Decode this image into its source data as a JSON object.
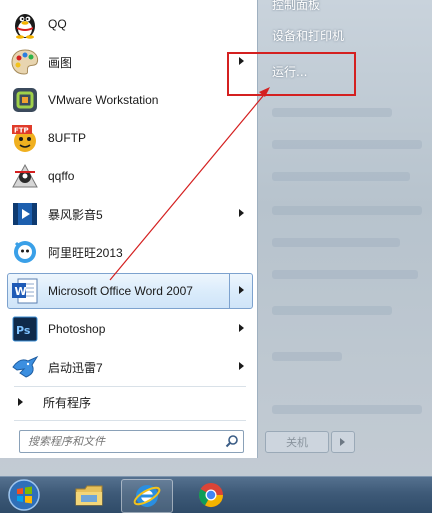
{
  "programs": [
    {
      "label": "QQ",
      "icon": "qq-penguin-icon",
      "has_arrow": false
    },
    {
      "label": "画图",
      "icon": "paint-palette-icon",
      "has_arrow": true
    },
    {
      "label": "VMware Workstation",
      "icon": "vmware-icon",
      "has_arrow": false
    },
    {
      "label": "8UFTP",
      "icon": "ftp-client-icon",
      "has_arrow": false
    },
    {
      "label": "qqffo",
      "icon": "qqffo-icon",
      "has_arrow": false
    },
    {
      "label": "暴风影音5",
      "icon": "baofeng-player-icon",
      "has_arrow": true
    },
    {
      "label": "阿里旺旺2013",
      "icon": "aliwangwang-icon",
      "has_arrow": false
    },
    {
      "label": "Microsoft Office Word 2007",
      "icon": "word-document-icon",
      "has_arrow": true,
      "highlighted": true
    },
    {
      "label": "Photoshop",
      "icon": "photoshop-icon",
      "has_arrow": true
    },
    {
      "label": "启动迅雷7",
      "icon": "thunder-bird-icon",
      "has_arrow": true
    }
  ],
  "all_programs_label": "所有程序",
  "search_placeholder": "搜索程序和文件",
  "right_pane": {
    "control_panel": "控制面板",
    "devices_printers": "设备和打印机",
    "run": "运行..."
  },
  "shutdown_label": "关机",
  "taskbar": [
    "start-orb-icon",
    "file-explorer-icon",
    "internet-explorer-icon",
    "chrome-icon"
  ],
  "colors": {
    "annotation_red": "#d42020",
    "highlight_border": "#7da2ce"
  }
}
